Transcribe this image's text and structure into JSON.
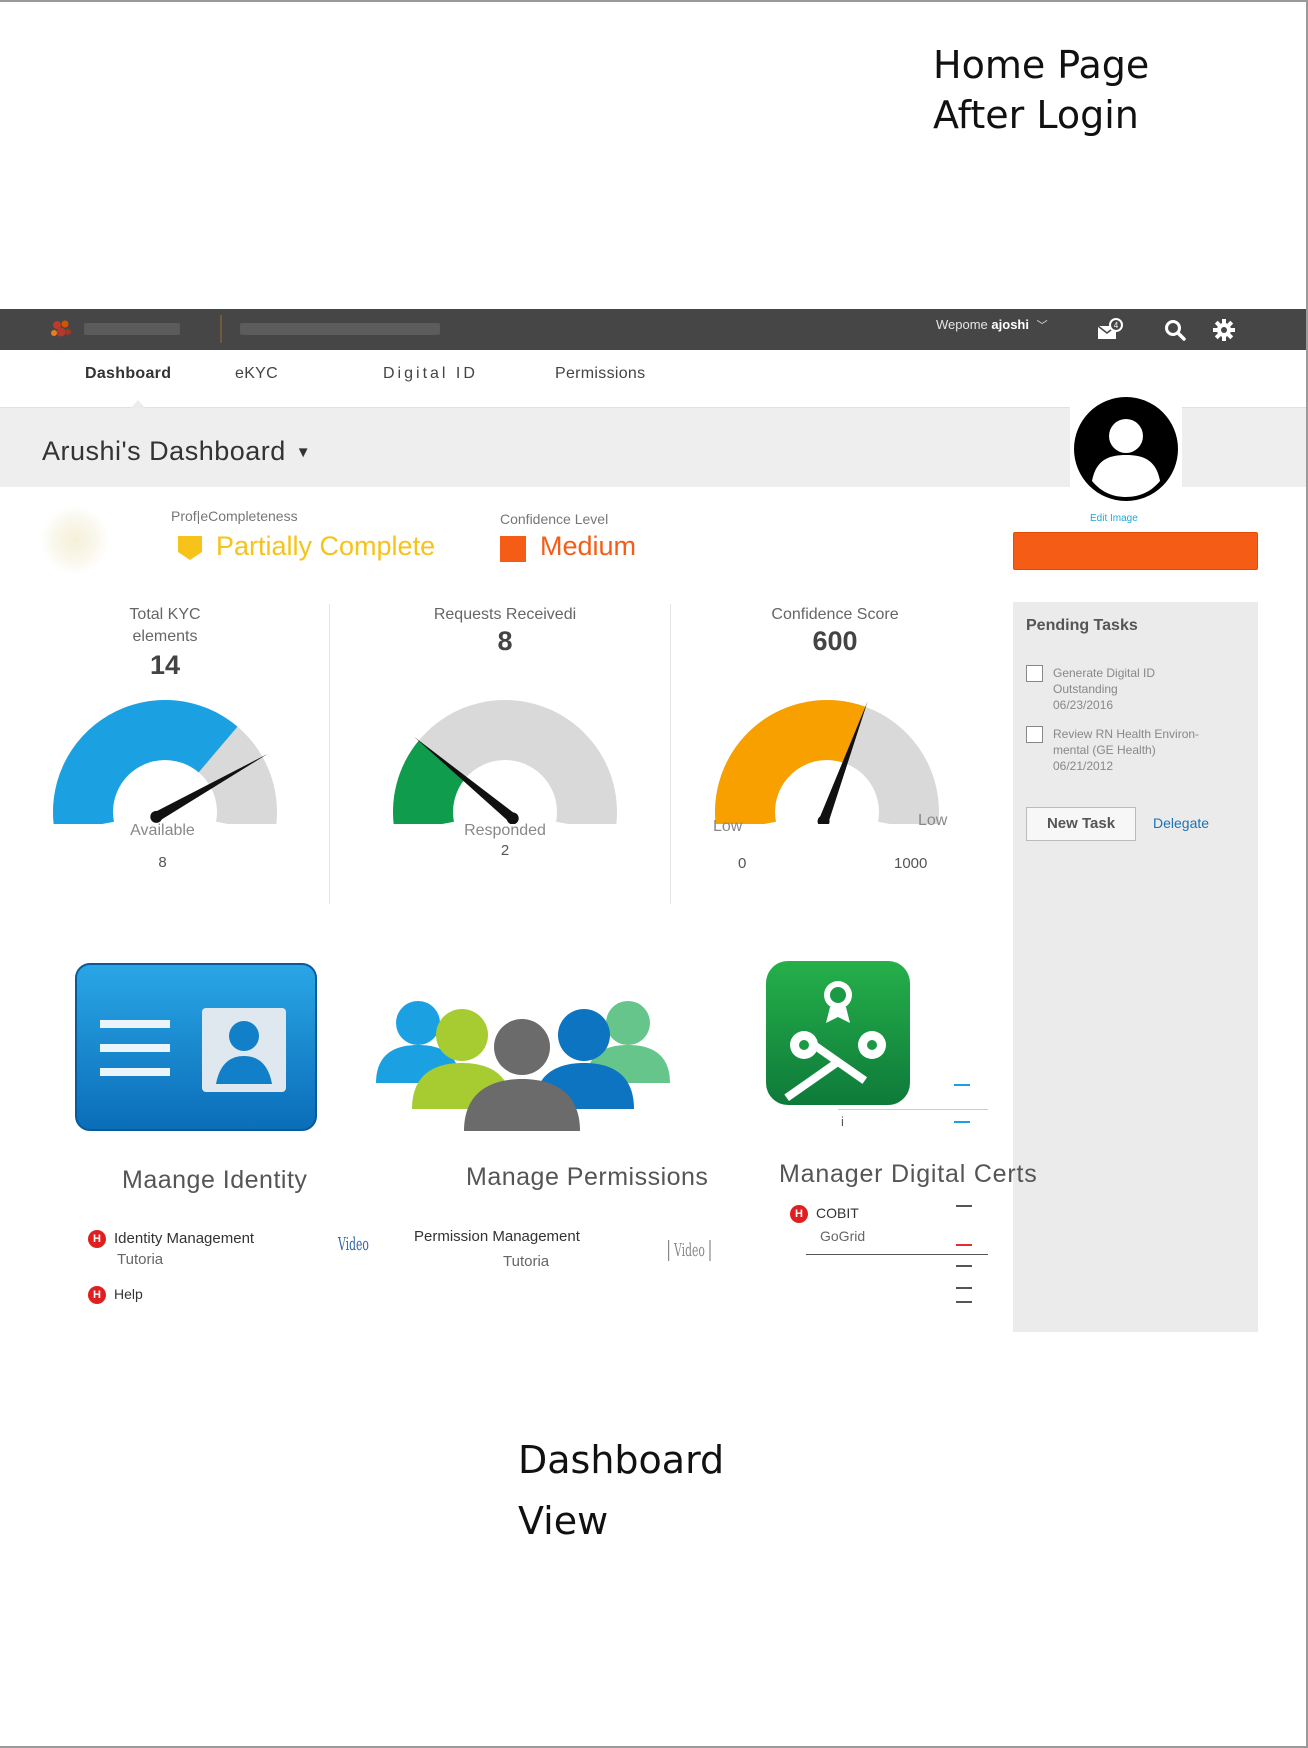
{
  "annotations": {
    "top_note": "Home Page\nAfter Login",
    "bottom_note": "Dashboard\nView"
  },
  "topbar": {
    "welcome_prefix": "Wepome",
    "username": "ajoshi"
  },
  "tabs": [
    {
      "label": "Dashboard",
      "active": true
    },
    {
      "label": "eKYC",
      "active": false
    },
    {
      "label": "Digital ID",
      "active": false
    },
    {
      "label": "Permissions",
      "active": false
    }
  ],
  "header": {
    "title": "Arushi's Dashboard",
    "edit_image": "Edit Image"
  },
  "status": {
    "profile_label": "Prof|eCompleteness",
    "profile_value": "Partially Complete",
    "profile_color": "#f7c21a",
    "confidence_label": "Confidence Level",
    "confidence_value": "Medium",
    "confidence_color": "#f55d17"
  },
  "gauges": [
    {
      "title": "Total KYC\nelements",
      "value": "14",
      "sub_label": "Available",
      "sub_value": "8",
      "fill": 0.7,
      "needle": 0.8,
      "color": "#1ba1e2"
    },
    {
      "title": "Requests Receivedi",
      "value": "8",
      "sub_label": "Responded",
      "sub_value": "2",
      "fill": 0.25,
      "needle": 0.25,
      "color": "#109c4d"
    },
    {
      "title": "Confidence Score",
      "value": "600",
      "left_label": "Low",
      "right_label": "Low",
      "min": "0",
      "max": "1000",
      "fill": 0.6,
      "needle": 0.6,
      "color": "#f8a000"
    }
  ],
  "pending": {
    "title": "Pending Tasks",
    "tasks": [
      {
        "text": "Generate Digital ID\nOutstanding\n06/23/2016"
      },
      {
        "text": "Review RN Health Environ-\nmental (GE Health)\n06/21/2012"
      }
    ],
    "new_task": "New Task",
    "delegate": "Delegate"
  },
  "tiles": {
    "identity": {
      "title": "Maange Identity",
      "link1": "Identity Management",
      "link1_sub": "Tutoria",
      "link2": "Help",
      "video": "Video"
    },
    "permissions": {
      "title": "Manage Permissions",
      "link1": "Permission Management",
      "link1_sub": "Tutoria",
      "video": "Video"
    },
    "certs": {
      "title": "Manager Digital Certs",
      "item1": "COBIT",
      "item1_sub": "GoGrid",
      "marker": "i"
    }
  },
  "colors": {
    "topbar": "#464646",
    "accent_blue": "#1ba1e2",
    "accent_green": "#109c4d",
    "accent_orange": "#f8a000",
    "button_orange": "#f55d17"
  }
}
